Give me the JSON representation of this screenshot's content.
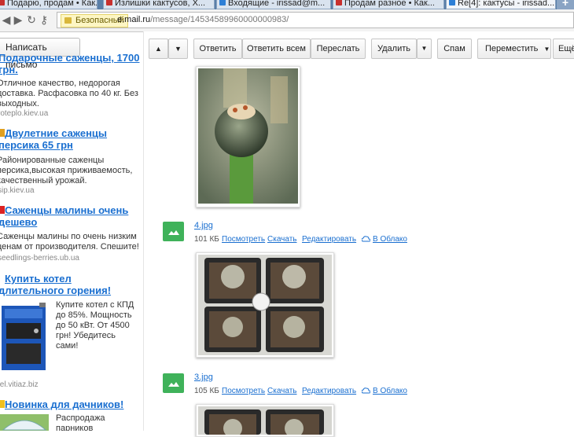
{
  "browser": {
    "tabs": [
      {
        "title": "Подарю, продам • Как..."
      },
      {
        "title": "Излишки кактусов, Х..."
      },
      {
        "title": "Входящие - irissad@m..."
      },
      {
        "title": "Продам разное • Как..."
      },
      {
        "title": "Re[4]: кактусы - irissad..."
      }
    ],
    "new_tab_label": "+",
    "secure_label": "Безопасный",
    "url_host": "e.mail.ru",
    "url_path": "/message/14534589960000000983/"
  },
  "sidebar": {
    "compose_label": "Написать письмо",
    "ads": [
      {
        "title_lines": [
          "Подарочные саженцы, 1700",
          "грн."
        ],
        "text": [
          "Отличное качество, недорогая",
          "доставка. Расфасовка по 40 кг. Без",
          "выходных."
        ],
        "domain": "roteplo.kiev.ua"
      },
      {
        "title_lines": [
          "Двулетние саженцы",
          "персика 65 грн"
        ],
        "text": [
          "Районированные саженцы",
          "персика,высокая приживаемость,",
          "качественный урожай."
        ],
        "domain": "sip.kiev.ua"
      },
      {
        "title_lines": [
          "Саженцы малины очень",
          "дешево"
        ],
        "text": [
          "Саженцы малины по очень низким",
          "ценам от производителя. Спешите!"
        ],
        "domain": "seedlings-berries.ub.ua"
      },
      {
        "title_lines": [
          "Купить котел",
          "длительного горения!"
        ],
        "text": [
          "Купите котел с КПД",
          "до 85%. Мощность",
          "до 50 кВт. От 4500",
          "грн! Убедитесь",
          "сами!"
        ],
        "domain": "tel.vitiaz.biz"
      },
      {
        "title_lines": [
          "Новинка для дачников!"
        ],
        "text": [
          "Распродажа",
          "парников"
        ],
        "domain": ""
      }
    ]
  },
  "toolbar": {
    "up_label": "▲",
    "down_label": "▼",
    "reply_label": "Ответить",
    "reply_all_label": "Ответить всем",
    "forward_label": "Переслать",
    "delete_label": "Удалить",
    "spam_label": "Спам",
    "move_label": "Переместить",
    "more_label": "Ещё"
  },
  "attachments": [
    {
      "name": "4.jpg",
      "size": "101 КБ",
      "view": "Посмотреть",
      "download": "Скачать",
      "edit": "Редактировать",
      "cloud": "В Облако"
    },
    {
      "name": "3.jpg",
      "size": "105 КБ",
      "view": "Посмотреть",
      "download": "Скачать",
      "edit": "Редактировать",
      "cloud": "В Облако"
    }
  ]
}
